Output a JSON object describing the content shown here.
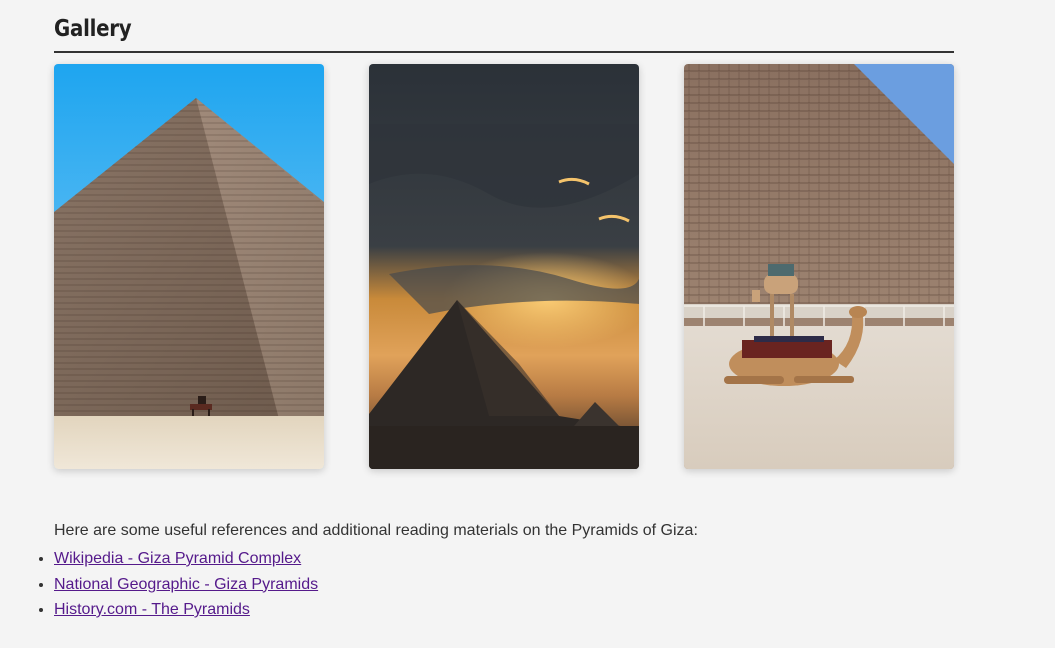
{
  "gallery": {
    "title": "Gallery",
    "images": [
      {
        "subject": "great-pyramid-blue-sky"
      },
      {
        "subject": "pyramid-sunset-clouds"
      },
      {
        "subject": "camels-at-pyramid-base"
      }
    ]
  },
  "references": {
    "intro": "Here are some useful references and additional reading materials on the Pyramids of Giza:",
    "links": [
      {
        "label": "Wikipedia - Giza Pyramid Complex"
      },
      {
        "label": "National Geographic - Giza Pyramids"
      },
      {
        "label": "History.com - The Pyramids"
      }
    ]
  },
  "colors": {
    "background": "#f4f4f4",
    "link_visited": "#551a8b",
    "text": "#333333"
  }
}
